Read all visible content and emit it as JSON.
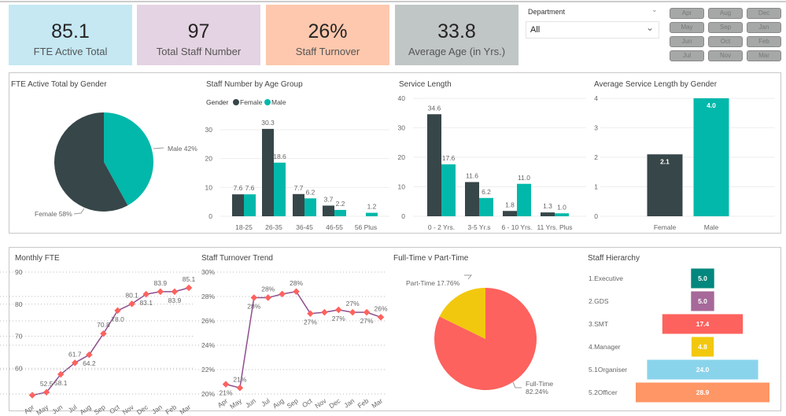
{
  "kpis": [
    {
      "value": "85.1",
      "label": "FTE Active Total",
      "color": "#c5e8f3"
    },
    {
      "value": "97",
      "label": "Total Staff Number",
      "color": "#e4d3e2"
    },
    {
      "value": "26%",
      "label": "Staff Turnover",
      "color": "#fdc8ae"
    },
    {
      "value": "33.8",
      "label": "Average Age (in Yrs.)",
      "color": "#c0c5c5"
    }
  ],
  "filter": {
    "label": "Department",
    "value": "All"
  },
  "months": [
    "Apr",
    "Aug",
    "Dec",
    "May",
    "Sep",
    "Jan",
    "Jun",
    "Oct",
    "Feb",
    "Jul",
    "Nov",
    "Mar"
  ],
  "colors": {
    "female": "#374649",
    "male": "#01b8aa",
    "line": "#8e4e8e",
    "marker": "#fd625e"
  },
  "chart_data": [
    {
      "type": "pie",
      "title": "FTE Active Total by Gender",
      "slices": [
        {
          "name": "Male",
          "value": 42,
          "label": "Male 42%",
          "color": "#01b8aa"
        },
        {
          "name": "Female",
          "value": 58,
          "label": "Female 58%",
          "color": "#374649"
        }
      ]
    },
    {
      "type": "bar",
      "title": "Staff Number by Age Group",
      "legend_title": "Gender",
      "legend": [
        "Female",
        "Male"
      ],
      "legend_position": "top-left",
      "categories": [
        "18-25",
        "26-35",
        "36-45",
        "46-55",
        "56 Plus"
      ],
      "series": [
        {
          "name": "Female",
          "values": [
            7.6,
            30.3,
            7.7,
            3.7,
            null
          ]
        },
        {
          "name": "Male",
          "values": [
            7.6,
            18.6,
            6.2,
            2.2,
            1.2
          ]
        }
      ],
      "yticks": [
        "0",
        "10",
        "20",
        "30"
      ],
      "ylim": [
        0,
        33
      ]
    },
    {
      "type": "bar",
      "title": "Service Length",
      "categories": [
        "0 - 2 Yrs.",
        "3-5 Yr.s",
        "6 - 10 Yrs.",
        "11 Yrs. Plus"
      ],
      "series": [
        {
          "name": "Female",
          "values": [
            34.6,
            11.6,
            1.8,
            1.3
          ]
        },
        {
          "name": "Male",
          "values": [
            17.6,
            6.2,
            11.0,
            1.0
          ]
        }
      ],
      "yticks": [
        "0",
        "10",
        "20",
        "30",
        "40"
      ],
      "ylim": [
        0,
        40
      ]
    },
    {
      "type": "bar",
      "title": "Average Service Length by Gender",
      "categories": [
        "Female",
        "Male"
      ],
      "values": [
        2.1,
        4.0
      ],
      "labels": [
        "2.1",
        "4.0"
      ],
      "yticks": [
        "0",
        "1",
        "2",
        "3",
        "4"
      ],
      "ylim": [
        0,
        4
      ]
    },
    {
      "type": "line",
      "title": "Monthly FTE",
      "categories": [
        "Apr",
        "May",
        "Jun",
        "Jul",
        "Aug",
        "Sep",
        "Oct",
        "Nov",
        "Dec",
        "Jan",
        "Feb",
        "Mar"
      ],
      "values": [
        51.6,
        52.5,
        58.1,
        61.7,
        64.2,
        70.8,
        78.0,
        80.1,
        83.1,
        83.9,
        83.9,
        85.1
      ],
      "labels": [
        "",
        "52.5",
        "58.1",
        "61.7",
        "64.2",
        "70.8",
        "78.0",
        "80.1",
        "83.1",
        "83.9",
        "83.9",
        "85.1"
      ],
      "yticks": [
        "60",
        "70",
        "80",
        "90"
      ],
      "ylim": [
        50,
        90
      ]
    },
    {
      "type": "line",
      "title": "Staff Turnover Trend",
      "categories": [
        "Apr",
        "May",
        "Jun",
        "Jul",
        "Aug",
        "Sep",
        "Oct",
        "Nov",
        "Dec",
        "Jan",
        "Feb",
        "Mar"
      ],
      "values": [
        20.8,
        20.5,
        27.9,
        27.9,
        28.2,
        28.4,
        26.6,
        26.7,
        26.9,
        26.7,
        26.7,
        26.3
      ],
      "labels": [
        "21%",
        "21%",
        "28%",
        "28%",
        "",
        "28%",
        "27%",
        "",
        "27%",
        "27%",
        "27%",
        "26%"
      ],
      "yticks": [
        "20%",
        "22%",
        "24%",
        "26%",
        "28%",
        "30%"
      ],
      "ylim": [
        20,
        30
      ]
    },
    {
      "type": "pie",
      "title": "Full-Time v Part-Time",
      "slices": [
        {
          "name": "Full-Time",
          "value": 82.24,
          "label": "Full-Time 82.24%",
          "color": "#fd625e"
        },
        {
          "name": "Part-Time",
          "value": 17.76,
          "label": "Part-Time 17.76%",
          "color": "#f2c80f"
        }
      ]
    },
    {
      "type": "bar",
      "title": "Staff Hierarchy",
      "orientation": "funnel",
      "categories": [
        "1.Executive",
        "2.GDS",
        "3.SMT",
        "4.Manager",
        "5.1Organiser",
        "5.2Officer"
      ],
      "values": [
        5.0,
        5.0,
        17.4,
        4.8,
        24.0,
        28.9
      ],
      "labels": [
        "5.0",
        "5.0",
        "17.4",
        "4.8",
        "24.0",
        "28.9"
      ],
      "colors": [
        "#01877d",
        "#a66999",
        "#fd625e",
        "#f2c80f",
        "#8ad4eb",
        "#fe9666"
      ]
    }
  ]
}
